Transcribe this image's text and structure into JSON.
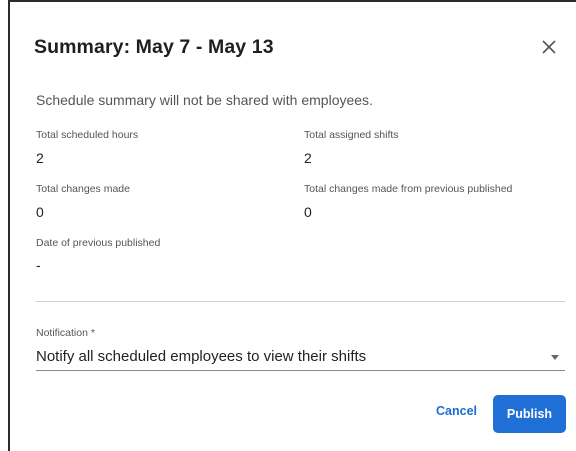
{
  "dialog": {
    "title": "Summary: May 7 - May 13",
    "close_icon": "close-icon",
    "subtitle": "Schedule summary will not be shared with employees."
  },
  "stats": {
    "total_scheduled_hours": {
      "label": "Total scheduled hours",
      "value": "2"
    },
    "total_assigned_shifts": {
      "label": "Total assigned shifts",
      "value": "2"
    },
    "total_changes_made": {
      "label": "Total changes made",
      "value": "0"
    },
    "total_changes_from_previous": {
      "label": "Total changes made from previous published",
      "value": "0"
    },
    "date_previous_published": {
      "label": "Date of previous published",
      "value": "-"
    }
  },
  "notification": {
    "label": "Notification *",
    "selected": "Notify all scheduled employees to view their shifts",
    "caret_icon": "caret-down-icon"
  },
  "actions": {
    "cancel_label": "Cancel",
    "publish_label": "Publish"
  },
  "colors": {
    "accent": "#1f6fd6",
    "link": "#1c6bd1"
  }
}
